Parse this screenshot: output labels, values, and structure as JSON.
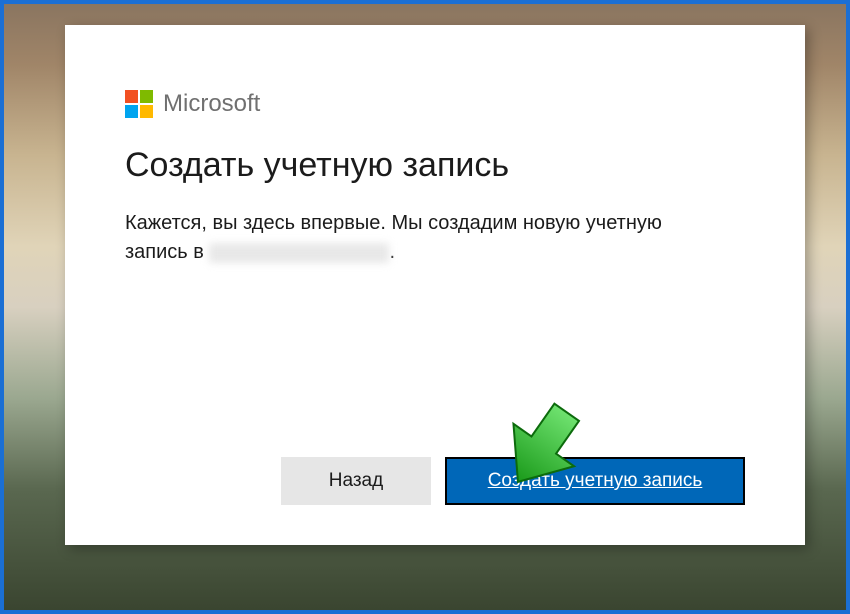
{
  "brand": {
    "name": "Microsoft",
    "colors": [
      "#f25022",
      "#7fba00",
      "#00a4ef",
      "#ffb900"
    ]
  },
  "dialog": {
    "title": "Создать учетную запись",
    "description_prefix": "Кажется, вы здесь впервые. Мы создадим новую учетную запись в ",
    "description_suffix": ".",
    "redacted_email": true
  },
  "buttons": {
    "back": "Назад",
    "create": "Создать учетную запись"
  },
  "accent_color": "#0067b8",
  "arrow_color": "#2fbc2f"
}
